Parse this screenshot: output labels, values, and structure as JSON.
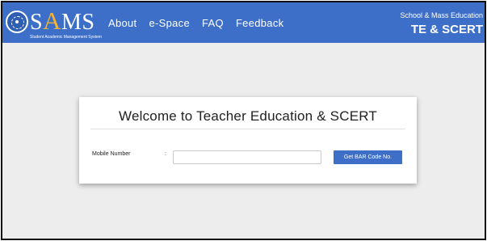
{
  "header": {
    "logo": {
      "word_start": "S",
      "word_mid": "A",
      "word_end": "MS",
      "tagline": "Student Academic Management System"
    },
    "nav": [
      "About",
      "e-Space",
      "FAQ",
      "Feedback"
    ],
    "dept_line1": "School & Mass Education",
    "dept_line2": "TE & SCERT"
  },
  "card": {
    "title": "Welcome to Teacher Education & SCERT",
    "field_label": "Mobile Number",
    "colon": ":",
    "input_value": "",
    "input_placeholder": "",
    "button_label": "Get BAR Code No."
  },
  "colors": {
    "header_bg": "#3d6fc8",
    "logo_accent": "#f2b233",
    "page_bg": "#ededed",
    "button_bg": "#3d6fc8"
  }
}
